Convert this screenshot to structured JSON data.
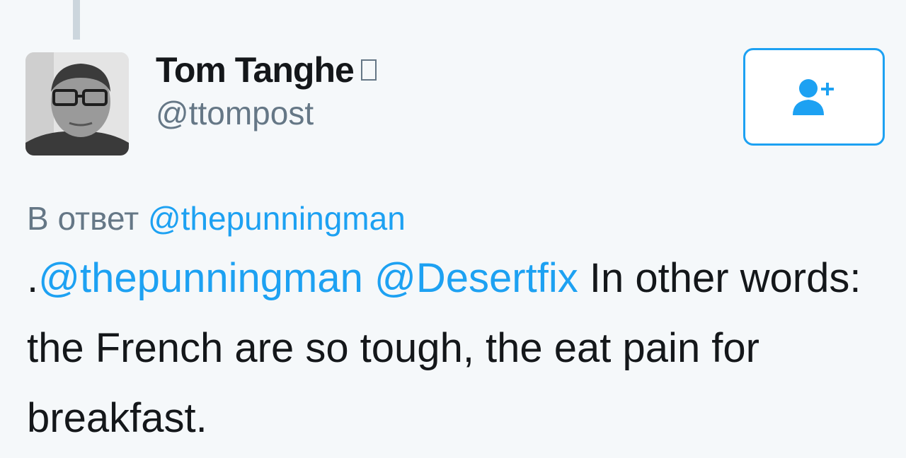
{
  "tweet": {
    "author": {
      "display_name": "Tom Tanghe",
      "handle": "@ttompost",
      "badge_icon": "missing-glyph-icon"
    },
    "follow_button": {
      "icon": "add-user-icon",
      "accent_color": "#1da1f2"
    },
    "reply_context": {
      "prefix": "В ответ",
      "mention": "@thepunningman"
    },
    "body": {
      "lead": ".",
      "mention_1": "@thepunningman",
      "mention_2": "@Desertfix",
      "text": " In other words: the French are so tough, the eat pain for breakfast."
    }
  },
  "colors": {
    "background": "#f5f8fa",
    "link": "#1da1f2",
    "secondary_text": "#657786",
    "primary_text": "#14171a"
  }
}
